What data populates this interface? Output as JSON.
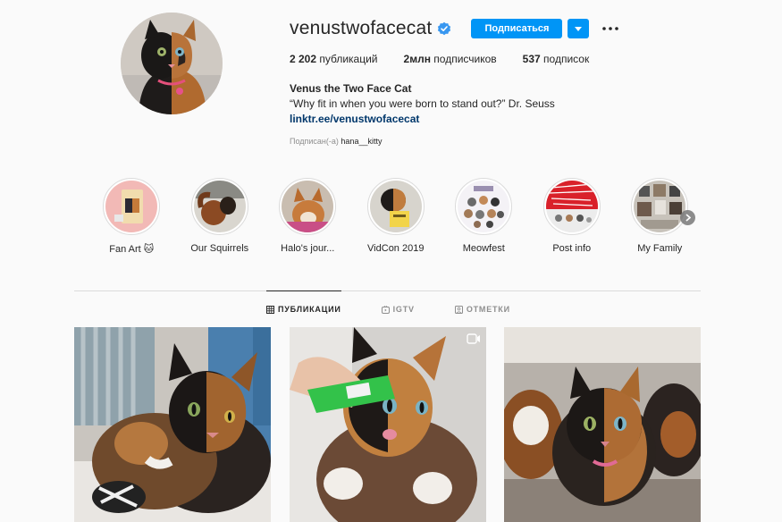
{
  "profile": {
    "username": "venustwofacecat",
    "follow_label": "Подписаться",
    "stats": {
      "posts_value": "2 202",
      "posts_label": "публикаций",
      "followers_value": "2млн",
      "followers_label": "подписчиков",
      "following_value": "537",
      "following_label": "подписок"
    },
    "bio": {
      "name": "Venus the Two Face Cat",
      "quote": "“Why fit in when you were born to stand out?” Dr. Seuss",
      "link": "linktr.ee/venustwofacecat"
    },
    "followed_by_prefix": "Подписан(-а)",
    "followed_by_user": "hana__kitty"
  },
  "highlights": [
    {
      "label": "Fan Art 🐱",
      "icon": "fan-art-cover"
    },
    {
      "label": "Our Squirrels",
      "icon": "squirrel-cover"
    },
    {
      "label": "Halo's jour...",
      "icon": "dog-cover"
    },
    {
      "label": "VidCon 2019",
      "icon": "vidcon-cover"
    },
    {
      "label": "Meowfest",
      "icon": "meowfest-cover"
    },
    {
      "label": "Post info",
      "icon": "post-info-cover"
    },
    {
      "label": "My Family",
      "icon": "family-cover"
    }
  ],
  "tabs": [
    {
      "label": "ПУБЛИКАЦИИ",
      "icon": "grid-icon",
      "active": true
    },
    {
      "label": "IGTV",
      "icon": "igtv-icon",
      "active": false
    },
    {
      "label": "ОТМЕТКИ",
      "icon": "tag-icon",
      "active": false
    }
  ],
  "colors": {
    "accent": "#0095f6",
    "link": "#00376b",
    "text": "#262626",
    "muted": "#8e8e8e",
    "background": "#fafafa",
    "border": "#dbdbdb"
  }
}
